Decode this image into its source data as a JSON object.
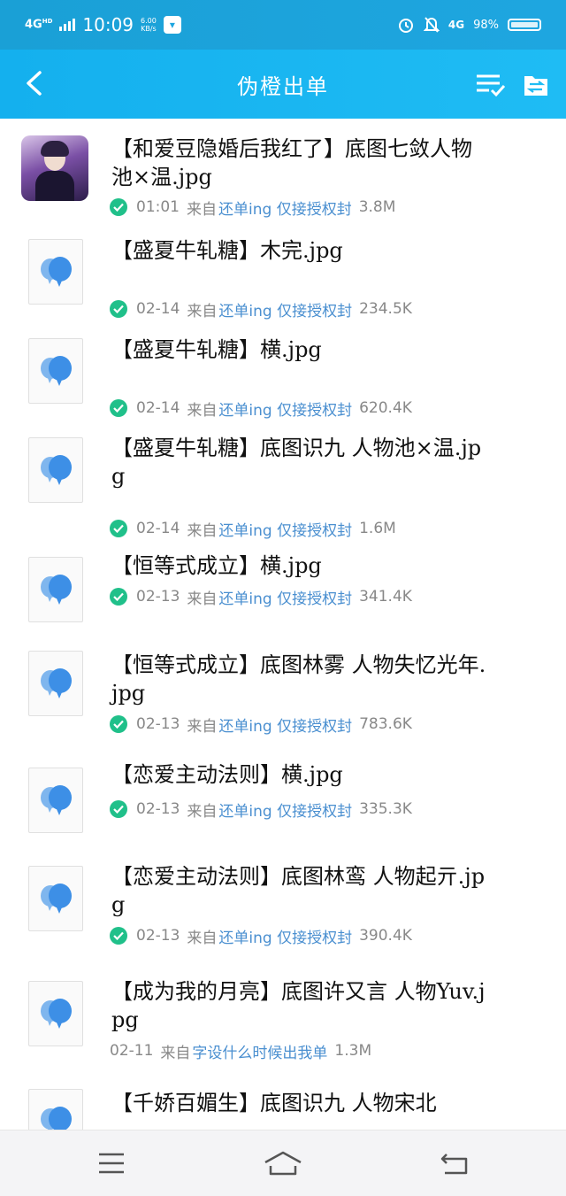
{
  "status_bar": {
    "network": "4G",
    "network_sup": "HD",
    "time": "10:09",
    "speed_value": "6.00",
    "speed_unit": "KB/s",
    "right_network": "4G",
    "battery": "98%"
  },
  "header": {
    "title": "伪橙出单"
  },
  "files": [
    {
      "name": "【和爱豆隐婚后我红了】底图七敛人物池×温.jpg",
      "date": "01:01",
      "from_label": "来自",
      "source": "还单ing 仅接授权封",
      "size": "3.8M",
      "checked": true,
      "thumb": "photo"
    },
    {
      "name": "【盛夏牛轧糖】木完.jpg",
      "date": "02-14",
      "from_label": "来自",
      "source": "还单ing 仅接授权封",
      "size": "234.5K",
      "checked": true,
      "thumb": "image-icon"
    },
    {
      "name": "【盛夏牛轧糖】横.jpg",
      "date": "02-14",
      "from_label": "来自",
      "source": "还单ing 仅接授权封",
      "size": "620.4K",
      "checked": true,
      "thumb": "image-icon"
    },
    {
      "name": "【盛夏牛轧糖】底图识九 人物池×温.jpg",
      "date": "02-14",
      "from_label": "来自",
      "source": "还单ing 仅接授权封",
      "size": "1.6M",
      "checked": true,
      "thumb": "image-icon"
    },
    {
      "name": "【恒等式成立】横.jpg",
      "date": "02-13",
      "from_label": "来自",
      "source": "还单ing 仅接授权封",
      "size": "341.4K",
      "checked": true,
      "thumb": "image-icon"
    },
    {
      "name": "【恒等式成立】底图林雾 人物失忆光年.jpg",
      "date": "02-13",
      "from_label": "来自",
      "source": "还单ing 仅接授权封",
      "size": "783.6K",
      "checked": true,
      "thumb": "image-icon"
    },
    {
      "name": "【恋爱主动法则】横.jpg",
      "date": "02-13",
      "from_label": "来自",
      "source": "还单ing 仅接授权封",
      "size": "335.3K",
      "checked": true,
      "thumb": "image-icon"
    },
    {
      "name": "【恋爱主动法则】底图林鸾 人物起亓.jpg",
      "date": "02-13",
      "from_label": "来自",
      "source": "还单ing 仅接授权封",
      "size": "390.4K",
      "checked": true,
      "thumb": "image-icon"
    },
    {
      "name": "【成为我的月亮】底图许又言 人物Yuv.jpg",
      "date": "02-11",
      "from_label": "来自",
      "source": "字设什么时候出我单",
      "size": "1.3M",
      "checked": false,
      "thumb": "image-icon"
    },
    {
      "name": "【千娇百媚生】底图识九 人物宋北",
      "date": "",
      "from_label": "",
      "source": "",
      "size": "",
      "checked": false,
      "thumb": "image-icon"
    }
  ],
  "bottom_nav": {
    "menu": "menu-icon",
    "home": "home-icon",
    "back": "back-icon"
  },
  "colors": {
    "header": "#1fbcf4",
    "check": "#20c08a",
    "source_link": "#4a8fd0",
    "thumb_icon": "#3d8fe6"
  }
}
